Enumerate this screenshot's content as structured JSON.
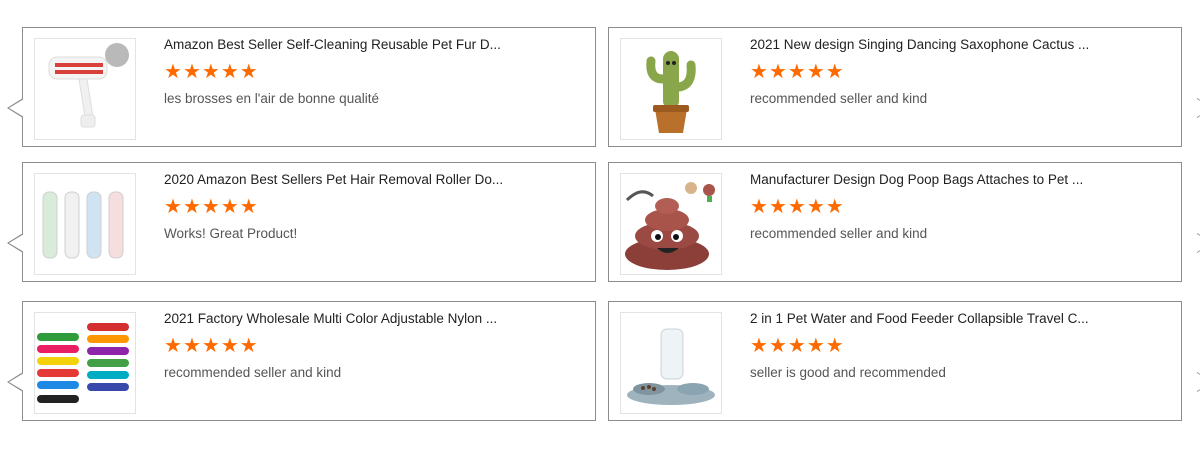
{
  "accent_color": "#ff6a00",
  "star_glyph": "★",
  "reviews": [
    {
      "title": "Amazon Best Seller Self-Cleaning Reusable Pet Fur D...",
      "rating": 5,
      "review": "les brosses en l'air de bonne qualité",
      "image_icon": "lint-roller-icon"
    },
    {
      "title": "2021 New design Singing Dancing Saxophone Cactus ...",
      "rating": 5,
      "review": "recommended seller and kind",
      "image_icon": "dancing-cactus-icon"
    },
    {
      "title": "2020 Amazon Best Sellers Pet Hair Removal Roller Do...",
      "rating": 5,
      "review": "Works! Great Product!",
      "image_icon": "hair-roller-set-icon"
    },
    {
      "title": "Manufacturer Design Dog Poop Bags Attaches to Pet ...",
      "rating": 5,
      "review": "recommended seller and kind",
      "image_icon": "poop-bag-holder-icon"
    },
    {
      "title": "2021 Factory Wholesale Multi Color Adjustable Nylon ...",
      "rating": 5,
      "review": "recommended seller and kind",
      "image_icon": "pet-collars-icon"
    },
    {
      "title": "2 in 1 Pet Water and Food Feeder Collapsible Travel C...",
      "rating": 5,
      "review": "seller is good and recommended",
      "image_icon": "pet-feeder-icon"
    }
  ]
}
